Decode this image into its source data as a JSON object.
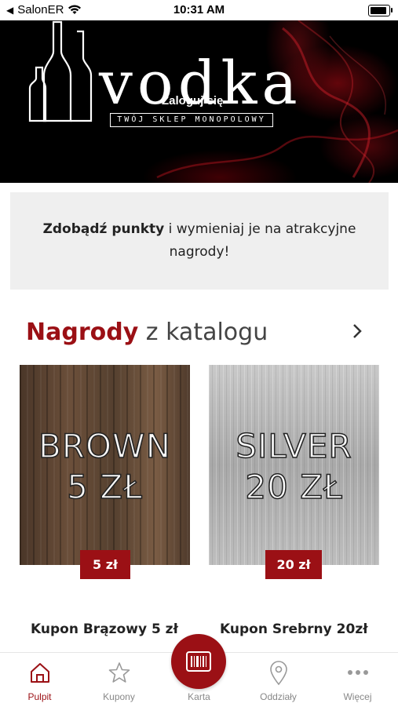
{
  "status_bar": {
    "carrier": "SalonER",
    "time": "10:31 AM"
  },
  "hero": {
    "brand": "vodka",
    "tagline": "TWÓJ SKLEP MONOPOLOWY",
    "login_label": "Zaloguj się"
  },
  "promo": {
    "bold_text": "Zdobądź punkty",
    "rest_text": " i wymieniaj je na atrakcyjne nagrody!"
  },
  "section": {
    "title_accent": "Nagrody",
    "title_rest": " z katalogu"
  },
  "cards": [
    {
      "line1": "BROWN",
      "line2": "5 ZŁ",
      "price": "5 zł",
      "name": "Kupon Brązowy 5 zł"
    },
    {
      "line1": "SILVER",
      "line2": "20 ZŁ",
      "price": "20 zł",
      "name": "Kupon Srebrny 20zł"
    }
  ],
  "tabs": [
    {
      "label": "Pulpit",
      "icon": "home-icon",
      "active": true
    },
    {
      "label": "Kupony",
      "icon": "star-icon",
      "active": false
    },
    {
      "label": "Karta",
      "icon": "barcode-icon",
      "active": false
    },
    {
      "label": "Oddziały",
      "icon": "map-pin-icon",
      "active": false
    },
    {
      "label": "Więcej",
      "icon": "more-icon",
      "active": false
    }
  ],
  "colors": {
    "accent": "#9b1015",
    "promo_bg": "#efefef"
  }
}
